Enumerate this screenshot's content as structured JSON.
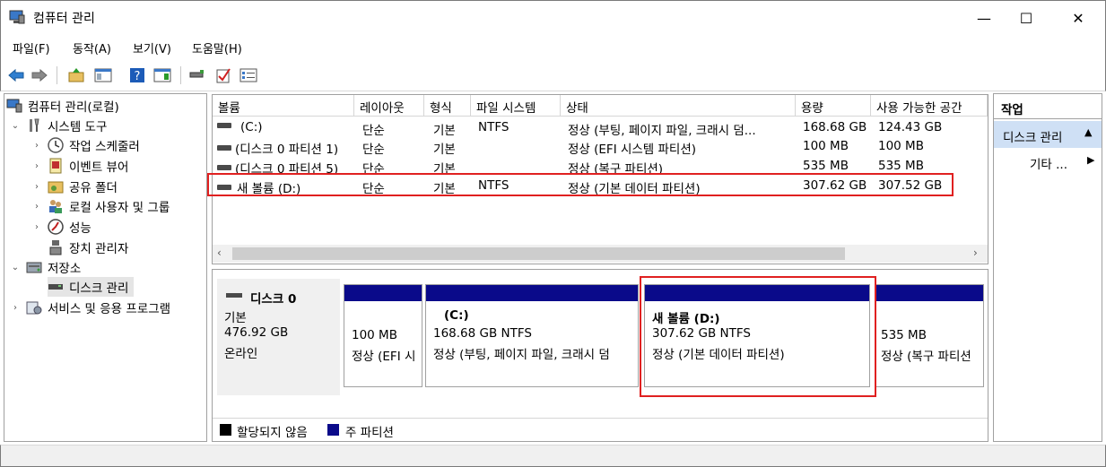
{
  "window": {
    "title": "컴퓨터 관리",
    "min_glyph": "—",
    "max_glyph": "☐",
    "close_glyph": "✕"
  },
  "menu": [
    "파일(F)",
    "동작(A)",
    "보기(V)",
    "도움말(H)"
  ],
  "toolbar_icons": [
    "back-arrow-icon",
    "forward-arrow-icon",
    "up-folder-icon",
    "show-tree-icon",
    "help-icon",
    "show-action-pane-icon",
    "connect-icon",
    "check-icon",
    "properties-icon"
  ],
  "tree": {
    "root": "컴퓨터 관리(로컬)",
    "system_tools": "시스템 도구",
    "task_scheduler": "작업 스케줄러",
    "event_viewer": "이벤트 뷰어",
    "shared_folders": "공유 폴더",
    "local_users": "로컬 사용자 및 그룹",
    "performance": "성능",
    "device_manager": "장치 관리자",
    "storage": "저장소",
    "disk_management": "디스크 관리",
    "services": "서비스 및 응용 프로그램"
  },
  "volume_table": {
    "headers": [
      "볼륨",
      "레이아웃",
      "형식",
      "파일 시스템",
      "상태",
      "용량",
      "사용 가능한 공간"
    ],
    "rows": [
      [
        "(C:)",
        "단순",
        "기본",
        "NTFS",
        "정상 (부팅, 페이지 파일, 크래시 덤...",
        "168.68 GB",
        "124.43 GB"
      ],
      [
        "(디스크 0 파티션 1)",
        "단순",
        "기본",
        "",
        "정상 (EFI 시스템 파티션)",
        "100 MB",
        "100 MB"
      ],
      [
        "(디스크 0 파티션 5)",
        "단순",
        "기본",
        "",
        "정상 (복구 파티션)",
        "535 MB",
        "535 MB"
      ],
      [
        "새 볼륨 (D:)",
        "단순",
        "기본",
        "NTFS",
        "정상 (기본 데이터 파티션)",
        "307.62 GB",
        "307.52 GB"
      ]
    ]
  },
  "disk": {
    "name": "디스크 0",
    "type": "기본",
    "size": "476.92 GB",
    "status": "온라인"
  },
  "partitions": [
    {
      "title": "",
      "size": "100 MB",
      "status": "정상 (EFI 시"
    },
    {
      "title": "(C:)",
      "size": "168.68 GB NTFS",
      "status": "정상 (부팅, 페이지 파일, 크래시 덤"
    },
    {
      "title": "새 볼륨  (D:)",
      "size": "307.62 GB NTFS",
      "status": "정상 (기본 데이터 파티션)"
    },
    {
      "title": "",
      "size": "535 MB",
      "status": "정상 (복구 파티션"
    }
  ],
  "legend": {
    "unallocated": "할당되지 않음",
    "primary": "주 파티션"
  },
  "actions": {
    "header": "작업",
    "section": "디스크 관리",
    "more": "기타 ..."
  },
  "colors": {
    "partition_bar": "#0a0a8a",
    "highlight": "#e02020",
    "action_section_bg": "#cfe0f5"
  }
}
